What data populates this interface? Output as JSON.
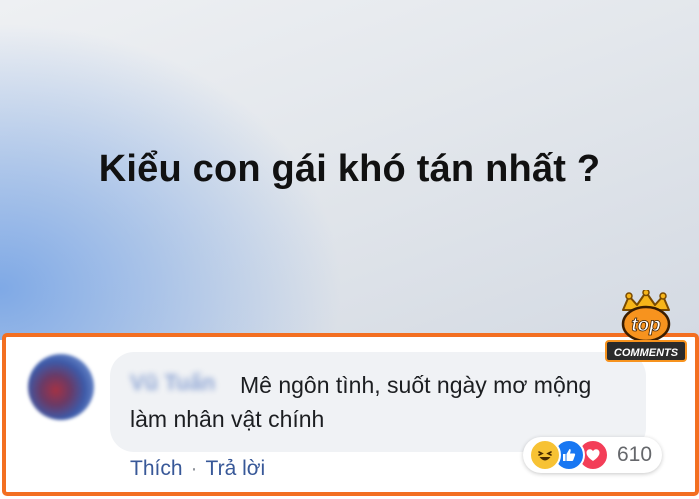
{
  "post": {
    "title": "Kiểu con gái khó tán nhất ?"
  },
  "comment": {
    "author": "Vũ Tuấn",
    "text": "Mê ngôn tình, suốt ngày mơ mộng làm nhân vật chính",
    "reactions": [
      "haha",
      "like",
      "love"
    ],
    "reaction_count": "610",
    "actions": {
      "like_label": "Thích",
      "separator": "·",
      "reply_label": "Trả lời"
    }
  },
  "badge": {
    "top_text": "top",
    "bottom_text": "COMMENTS"
  },
  "colors": {
    "frame": "#f36f21",
    "bubble": "#f0f2f5",
    "link": "#385898"
  }
}
